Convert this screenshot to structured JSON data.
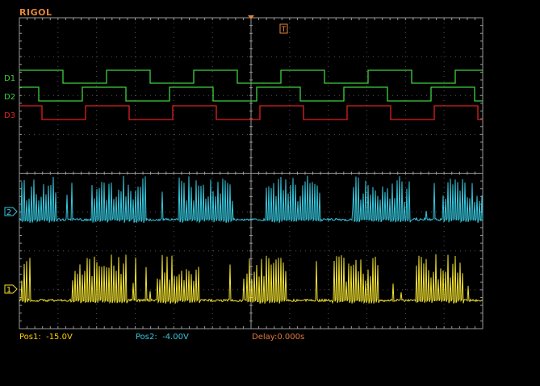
{
  "brand": "RIGOL",
  "status": {
    "pos1": "Pos1:  -15.0V",
    "pos2": "Pos2:  -4.00V",
    "delay": "Delay:0.000s"
  },
  "channels": {
    "d1": "D1",
    "d2": "D2",
    "d3": "D3",
    "ch2": "2",
    "ch1": "1",
    "trigger": "T"
  },
  "colors": {
    "digital": "#3fd03f",
    "d3": "#e02020",
    "ch2": "#36c6dc",
    "ch1": "#f0e030",
    "grid": "#9a9a9a",
    "accent": "#e0863a"
  }
}
